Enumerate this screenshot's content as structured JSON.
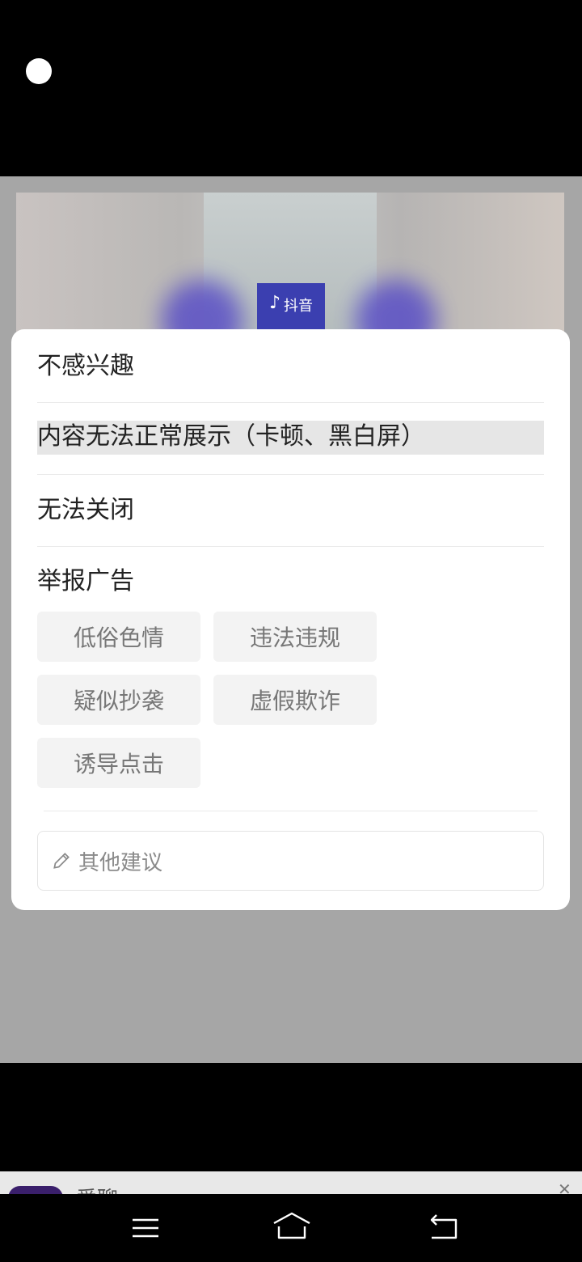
{
  "ad": {
    "badge_text": "抖音"
  },
  "sheet": {
    "options": [
      {
        "label": "不感兴趣"
      },
      {
        "label": "内容无法正常展示（卡顿、黑白屏）"
      },
      {
        "label": "无法关闭"
      }
    ],
    "report_title": "举报广告",
    "report_reasons": [
      "低俗色情",
      "违法违规",
      "疑似抄袭",
      "虚假欺诈",
      "诱导点击"
    ],
    "suggestion_placeholder": "其他建议"
  },
  "bottom_banner": {
    "app_name": "爱聊",
    "close_label": "✕"
  },
  "icons": {
    "menu": "menu-icon",
    "home": "home-icon",
    "back": "back-icon",
    "pencil": "pencil-icon"
  }
}
